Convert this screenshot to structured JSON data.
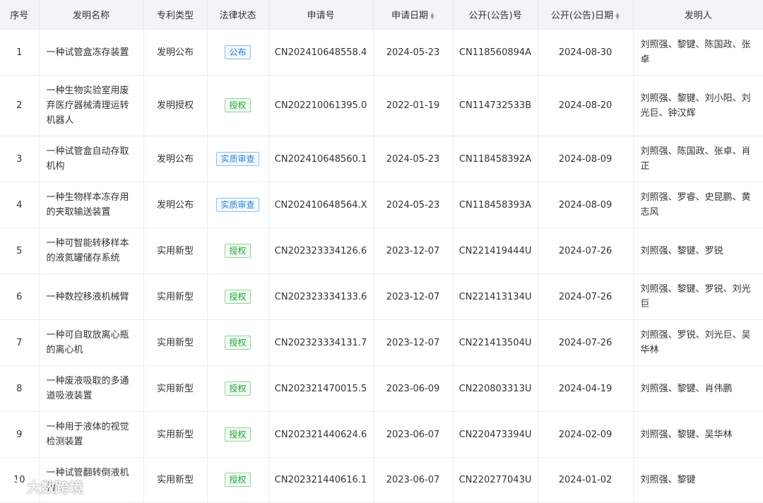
{
  "headers": {
    "index": "序号",
    "name": "发明名称",
    "patent_type": "专利类型",
    "legal_status": "法律状态",
    "application_no": "申请号",
    "application_date": "申请日期",
    "publication_no": "公开(公告)号",
    "publication_date": "公开(公告)日期",
    "inventors": "发明人"
  },
  "rows": [
    {
      "index": "1",
      "name": "一种试管盒冻存装置",
      "patent_type": "发明公布",
      "legal_status": "公布",
      "application_no": "CN202410648558.4",
      "application_date": "2024-05-23",
      "publication_no": "CN118560894A",
      "publication_date": "2024-08-30",
      "inventors": "刘照强、黎键、陈国政、张卓"
    },
    {
      "index": "2",
      "name": "一种生物实验室用废弃医疗器械清理运转机器人",
      "patent_type": "发明授权",
      "legal_status": "授权",
      "application_no": "CN202210061395.0",
      "application_date": "2022-01-19",
      "publication_no": "CN114732533B",
      "publication_date": "2024-08-20",
      "inventors": "刘照强、黎键、刘小阳、刘光巨、钟汉辉"
    },
    {
      "index": "3",
      "name": "一种试管盒自动存取机构",
      "patent_type": "发明公布",
      "legal_status": "实质审查",
      "application_no": "CN202410648560.1",
      "application_date": "2024-05-23",
      "publication_no": "CN118458392A",
      "publication_date": "2024-08-09",
      "inventors": "刘照强、陈国政、张卓、肖正"
    },
    {
      "index": "4",
      "name": "一种生物样本冻存用的夹取输送装置",
      "patent_type": "发明公布",
      "legal_status": "实质审查",
      "application_no": "CN202410648564.X",
      "application_date": "2024-05-23",
      "publication_no": "CN118458393A",
      "publication_date": "2024-08-09",
      "inventors": "刘照强、罗睿、史昆鹏、黄志风"
    },
    {
      "index": "5",
      "name": "一种可智能转移样本的液氮罐储存系统",
      "patent_type": "实用新型",
      "legal_status": "授权",
      "application_no": "CN202323334126.6",
      "application_date": "2023-12-07",
      "publication_no": "CN221419444U",
      "publication_date": "2024-07-26",
      "inventors": "刘照强、黎键、罗锐"
    },
    {
      "index": "6",
      "name": "一种数控移液机械臂",
      "patent_type": "实用新型",
      "legal_status": "授权",
      "application_no": "CN202323334133.6",
      "application_date": "2023-12-07",
      "publication_no": "CN221413134U",
      "publication_date": "2024-07-26",
      "inventors": "刘照强、黎键、罗锐、刘光巨"
    },
    {
      "index": "7",
      "name": "一种可自取放离心瓶的离心机",
      "patent_type": "实用新型",
      "legal_status": "授权",
      "application_no": "CN202323334131.7",
      "application_date": "2023-12-07",
      "publication_no": "CN221413504U",
      "publication_date": "2024-07-26",
      "inventors": "刘照强、罗锐、刘光巨、吴华林"
    },
    {
      "index": "8",
      "name": "一种废液吸取的多通道吸液装置",
      "patent_type": "实用新型",
      "legal_status": "授权",
      "application_no": "CN202321470015.5",
      "application_date": "2023-06-09",
      "publication_no": "CN220803313U",
      "publication_date": "2024-04-19",
      "inventors": "刘照强、黎键、肖伟鹏"
    },
    {
      "index": "9",
      "name": "一种用于液体的视觉检测装置",
      "patent_type": "实用新型",
      "legal_status": "授权",
      "application_no": "CN202321440624.6",
      "application_date": "2023-06-07",
      "publication_no": "CN220473394U",
      "publication_date": "2024-02-09",
      "inventors": "刘照强、黎键、吴华林"
    },
    {
      "index": "10",
      "name": "一种试管翻转倒液机构",
      "patent_type": "实用新型",
      "legal_status": "授权",
      "application_no": "CN202321440616.1",
      "application_date": "2023-06-07",
      "publication_no": "CN220277043U",
      "publication_date": "2024-01-02",
      "inventors": "刘照强、黎键"
    }
  ],
  "status_styles": {
    "公布": "gongbu",
    "授权": "shouquan",
    "实质审查": "shencha"
  },
  "watermark": {
    "text": "大数跨境",
    "icon": "wechat-logo-icon"
  }
}
